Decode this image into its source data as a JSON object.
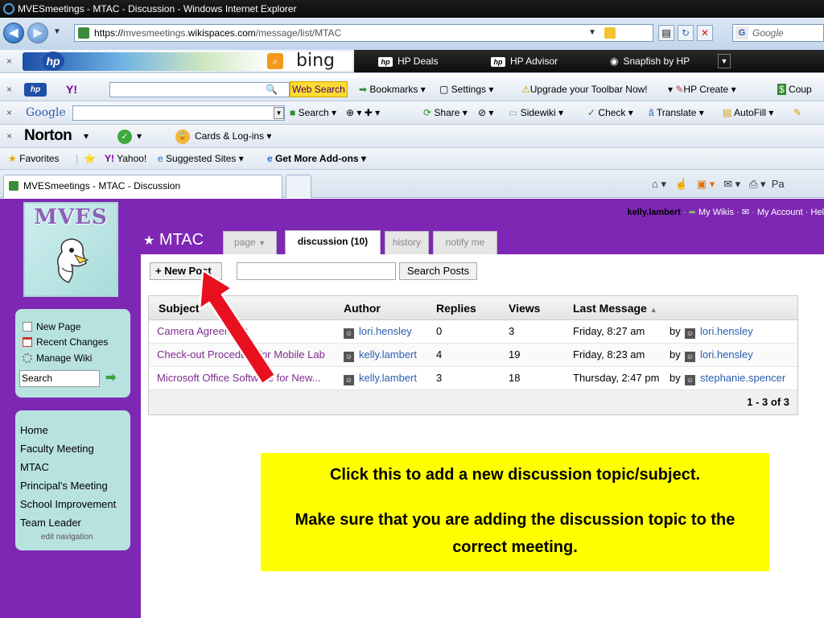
{
  "browser": {
    "window_title": "MVESmeetings - MTAC - Discussion - Windows Internet Explorer",
    "url_prefix": "https://",
    "url_domain_pre": "mvesmeetings.",
    "url_domain": "wikispaces.com",
    "url_path": "/message/list/MTAC",
    "search_placeholder": "Google",
    "tab_title": "MVESmeetings - MTAC - Discussion",
    "tab_extra": "Pa"
  },
  "toolbars": {
    "hp": {
      "bing": "bing",
      "links": [
        "HP Deals",
        "HP Advisor",
        "Snapfish by HP"
      ]
    },
    "yahoo": {
      "web_search": "Web Search",
      "items": [
        "Bookmarks",
        "Settings",
        "Upgrade your Toolbar Now!",
        "HP Create",
        "Coup"
      ]
    },
    "google": {
      "logo": "Google",
      "items": [
        "Search",
        "Share",
        "Sidewiki",
        "Check",
        "Translate",
        "AutoFill"
      ]
    },
    "norton": {
      "logo": "Norton",
      "cards": "Cards & Log-ins"
    },
    "favorites": {
      "favorites": "Favorites",
      "items": [
        "Yahoo!",
        "Suggested Sites",
        "Get More Add-ons"
      ]
    }
  },
  "wiki": {
    "logo_text": "MVES",
    "user": "kelly.lambert",
    "user_links": [
      "My Wikis",
      "My Account",
      "Hel"
    ],
    "page_title": "MTAC",
    "tabs": [
      {
        "label": "page"
      },
      {
        "label": "discussion (10)"
      },
      {
        "label": "history"
      },
      {
        "label": "notify me"
      }
    ],
    "sidebar_actions": [
      "New Page",
      "Recent Changes",
      "Manage Wiki"
    ],
    "sidebar_search_value": "Search",
    "nav": [
      "Home",
      "Faculty Meeting",
      "MTAC",
      "Principal's Meeting",
      "School Improvement",
      "Team Leader"
    ],
    "edit_navigation": "edit navigation",
    "new_post_label": "+ New Post",
    "search_posts_label": "Search Posts",
    "columns": [
      "Subject",
      "Author",
      "Replies",
      "Views",
      "Last Message"
    ],
    "rows": [
      {
        "subject": "Camera Agreement",
        "author": "lori.hensley",
        "replies": "0",
        "views": "3",
        "last": "Friday, 8:27 am",
        "by": "by",
        "last_user": "lori.hensley"
      },
      {
        "subject": "Check-out Procedure for Mobile Lab",
        "author": "kelly.lambert",
        "replies": "4",
        "views": "19",
        "last": "Friday, 8:23 am",
        "by": "by",
        "last_user": "lori.hensley"
      },
      {
        "subject": "Microsoft Office Software for New...",
        "author": "kelly.lambert",
        "replies": "3",
        "views": "18",
        "last": "Thursday, 2:47 pm",
        "by": "by",
        "last_user": "stephanie.spencer"
      }
    ],
    "pagination": "1 - 3 of 3"
  },
  "callout": {
    "line1": "Click this to add a new discussion topic/subject.",
    "line2": "Make sure that you are adding the discussion topic to the correct meeting."
  },
  "colors": {
    "purple": "#7e27b5",
    "sidebar": "#b8e2e0",
    "callout": "#ffff00",
    "arrow": "#e8101e"
  }
}
